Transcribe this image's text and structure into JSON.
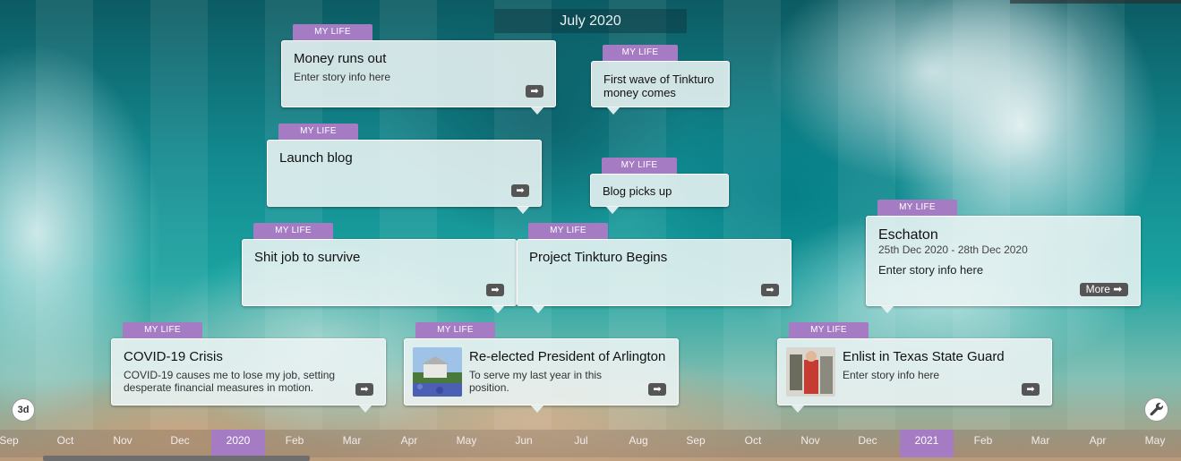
{
  "header": {
    "current_month": "July 2020"
  },
  "controls": {
    "view_3d_label": "3d",
    "settings_icon": "wrench-icon"
  },
  "colors": {
    "accent": "#a57bc3",
    "card_bg": "#ecf4f4",
    "button": "#555555"
  },
  "stories": [
    {
      "category": "MY LIFE",
      "title": "Money runs out",
      "desc": "Enter story info here",
      "action": "arrow-icon"
    },
    {
      "category": "MY LIFE",
      "title": "First wave of Tinkturo money comes",
      "desc": ""
    },
    {
      "category": "MY LIFE",
      "title": "Launch blog",
      "desc": "",
      "action": "arrow-icon"
    },
    {
      "category": "MY LIFE",
      "title": "Blog picks up",
      "desc": ""
    },
    {
      "category": "MY LIFE",
      "title": "Shit job to survive",
      "desc": "",
      "action": "arrow-icon"
    },
    {
      "category": "MY LIFE",
      "title": "Project Tinkturo Begins",
      "desc": "",
      "action": "arrow-icon"
    },
    {
      "category": "MY LIFE",
      "title": "Eschaton",
      "dates": "25th Dec 2020 - 28th Dec 2020",
      "desc": "Enter story info here",
      "more_label": "More"
    },
    {
      "category": "MY LIFE",
      "title": "COVID-19 Crisis",
      "desc": "COVID-19 causes me to lose my job, setting desperate financial measures in motion.",
      "action": "arrow-icon"
    },
    {
      "category": "MY LIFE",
      "title": "Re-elected President of Arlington",
      "desc": "To serve my last year in this position.",
      "action": "arrow-icon"
    },
    {
      "category": "MY LIFE",
      "title": "Enlist in Texas State Guard",
      "desc": "Enter story info here",
      "action": "arrow-icon"
    }
  ],
  "axis": {
    "months": [
      "Sep",
      "Oct",
      "Nov",
      "Dec",
      "2020",
      "Feb",
      "Mar",
      "Apr",
      "May",
      "Jun",
      "Jul",
      "Aug",
      "Sep",
      "Oct",
      "Nov",
      "Dec",
      "2021",
      "Feb",
      "Mar",
      "Apr",
      "May"
    ],
    "year_markers": [
      "2020",
      "2021"
    ]
  }
}
